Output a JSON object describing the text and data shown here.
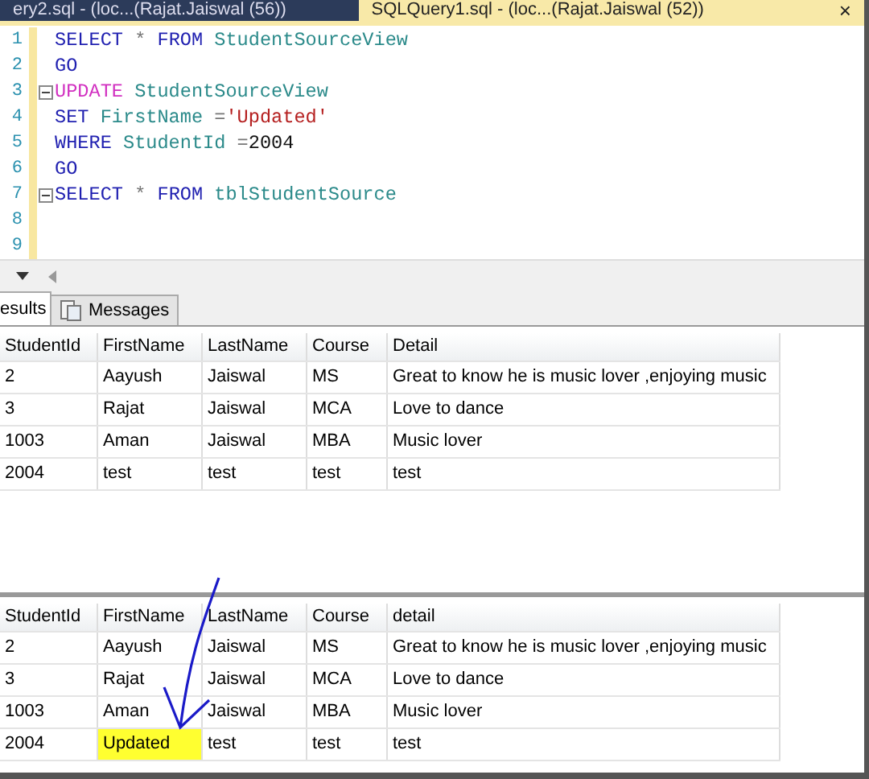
{
  "doc_tabs": [
    {
      "label": "ery2.sql - (loc...(Rajat.Jaiswal (56))",
      "selected": false
    },
    {
      "label": "SQLQuery1.sql - (loc...(Rajat.Jaiswal (52))",
      "selected": true,
      "close": "×"
    }
  ],
  "editor": {
    "lines": [
      {
        "number": "1",
        "collapse": false,
        "tokens": [
          {
            "kind": "keyword",
            "text": "SELECT"
          },
          {
            "kind": "op",
            "text": " * "
          },
          {
            "kind": "keyword",
            "text": "FROM"
          },
          {
            "kind": "ident",
            "text": " StudentSourceView"
          }
        ]
      },
      {
        "number": "2",
        "collapse": false,
        "tokens": [
          {
            "kind": "keyword",
            "text": "GO"
          }
        ]
      },
      {
        "number": "3",
        "collapse": true,
        "tokens": [
          {
            "kind": "dml",
            "text": "UPDATE"
          },
          {
            "kind": "ident",
            "text": " StudentSourceView"
          }
        ]
      },
      {
        "number": "4",
        "collapse": false,
        "tokens": [
          {
            "kind": "keyword",
            "text": "SET"
          },
          {
            "kind": "ident",
            "text": " FirstName "
          },
          {
            "kind": "op",
            "text": "="
          },
          {
            "kind": "string",
            "text": "'Updated'"
          }
        ]
      },
      {
        "number": "5",
        "collapse": false,
        "tokens": [
          {
            "kind": "keyword",
            "text": "WHERE"
          },
          {
            "kind": "ident",
            "text": " StudentId "
          },
          {
            "kind": "op",
            "text": "="
          },
          {
            "kind": "number",
            "text": "2004"
          }
        ]
      },
      {
        "number": "6",
        "collapse": false,
        "tokens": [
          {
            "kind": "keyword",
            "text": "GO"
          }
        ]
      },
      {
        "number": "7",
        "collapse": true,
        "tokens": [
          {
            "kind": "keyword",
            "text": "SELECT"
          },
          {
            "kind": "op",
            "text": " * "
          },
          {
            "kind": "keyword",
            "text": "FROM"
          },
          {
            "kind": "ident",
            "text": " tblStudentSource"
          }
        ]
      },
      {
        "number": "8",
        "collapse": false
      },
      {
        "number": "9",
        "collapse": false
      }
    ]
  },
  "result_tabs": [
    {
      "label": "esults",
      "selected": true,
      "icon": false
    },
    {
      "label": "Messages",
      "selected": false,
      "icon": true
    }
  ],
  "grids": [
    {
      "columns": [
        "StudentId",
        "FirstName",
        "LastName",
        "Course",
        "Detail"
      ],
      "rows": [
        {
          "cells": [
            {
              "text": "2"
            },
            {
              "text": "Aayush"
            },
            {
              "text": "Jaiswal"
            },
            {
              "text": "MS"
            },
            {
              "text": "Great to know he is  music lover ,enjoying music"
            }
          ]
        },
        {
          "cells": [
            {
              "text": "3"
            },
            {
              "text": "Rajat"
            },
            {
              "text": "Jaiswal"
            },
            {
              "text": "MCA"
            },
            {
              "text": "Love to dance"
            }
          ]
        },
        {
          "cells": [
            {
              "text": "1003"
            },
            {
              "text": "Aman"
            },
            {
              "text": "Jaiswal"
            },
            {
              "text": "MBA"
            },
            {
              "text": "Music lover"
            }
          ]
        },
        {
          "cells": [
            {
              "text": "2004"
            },
            {
              "text": "test"
            },
            {
              "text": "test"
            },
            {
              "text": "test"
            },
            {
              "text": "test"
            }
          ]
        }
      ]
    },
    {
      "columns": [
        "StudentId",
        "FirstName",
        "LastName",
        "Course",
        "detail"
      ],
      "rows": [
        {
          "cells": [
            {
              "text": "2"
            },
            {
              "text": "Aayush"
            },
            {
              "text": "Jaiswal"
            },
            {
              "text": "MS"
            },
            {
              "text": "Great to know he is  music lover ,enjoying music"
            }
          ]
        },
        {
          "cells": [
            {
              "text": "3"
            },
            {
              "text": "Rajat"
            },
            {
              "text": "Jaiswal"
            },
            {
              "text": "MCA"
            },
            {
              "text": "Love to dance"
            }
          ]
        },
        {
          "cells": [
            {
              "text": "1003"
            },
            {
              "text": "Aman"
            },
            {
              "text": "Jaiswal"
            },
            {
              "text": "MBA"
            },
            {
              "text": "Music lover"
            }
          ]
        },
        {
          "cells": [
            {
              "text": "2004"
            },
            {
              "text": "Updated",
              "highlighted": true
            },
            {
              "text": "test"
            },
            {
              "text": "test"
            },
            {
              "text": "test"
            }
          ]
        }
      ]
    }
  ]
}
